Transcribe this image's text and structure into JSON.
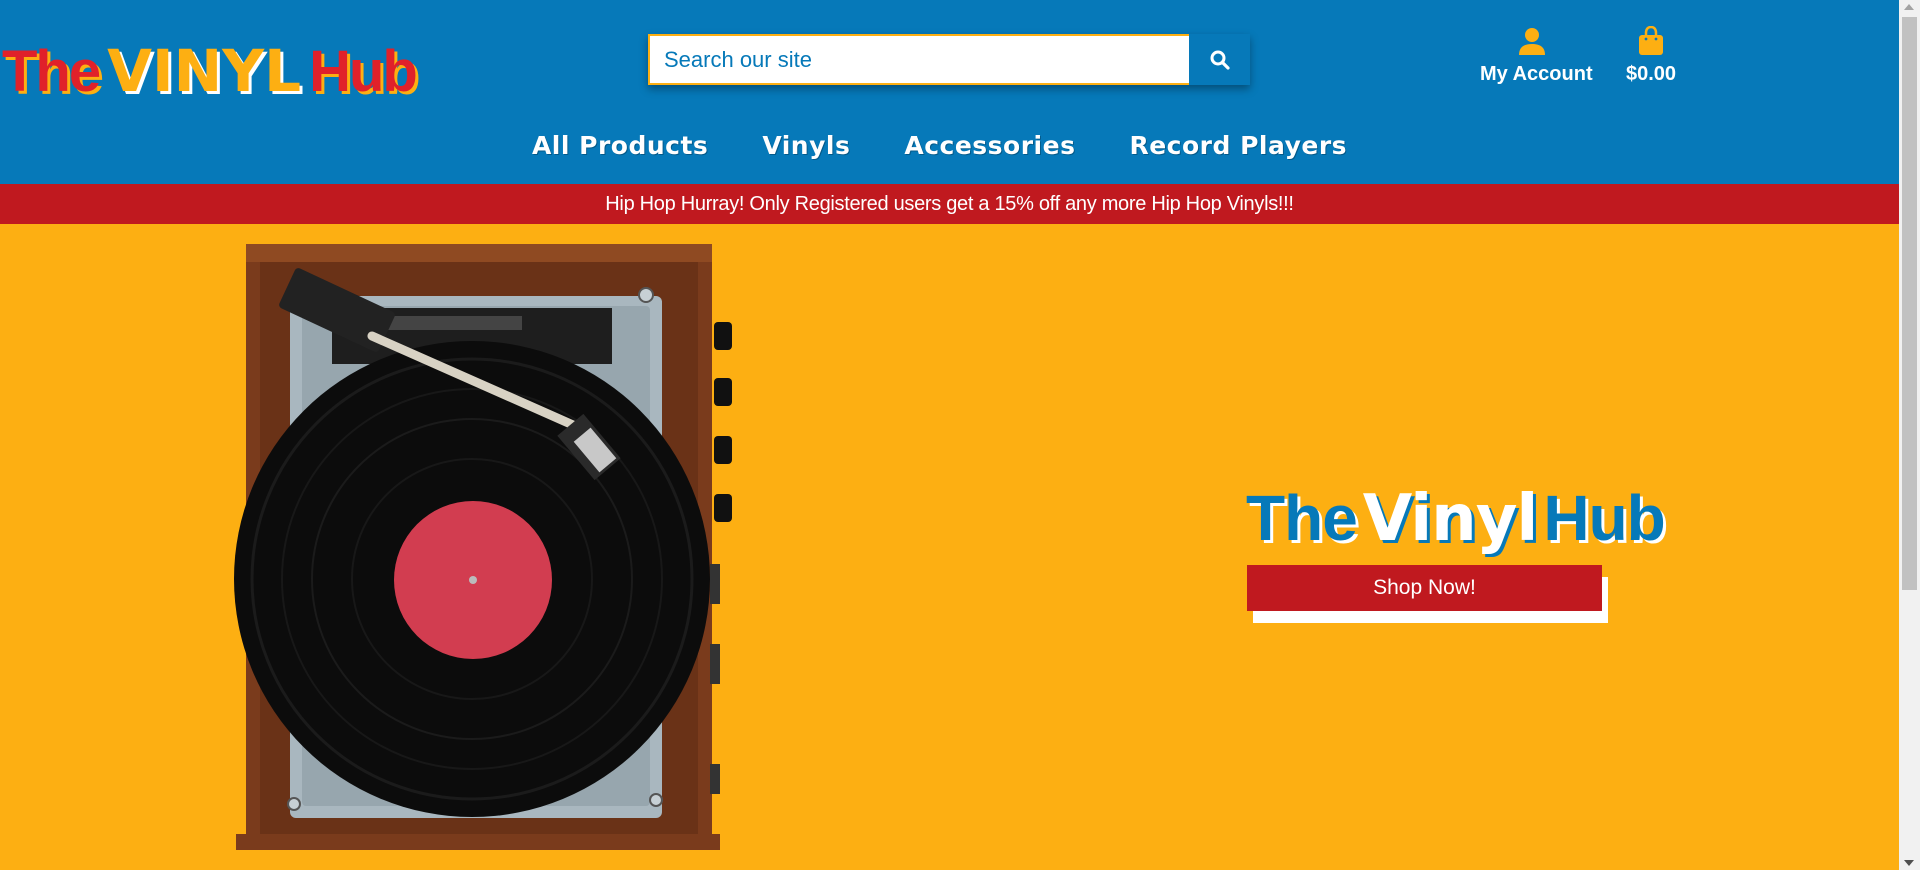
{
  "header": {
    "logo": {
      "word1": "The",
      "word2": "VINYL",
      "word3": "Hub"
    },
    "search": {
      "placeholder": "Search our site",
      "value": ""
    },
    "account_label": "My Account",
    "cart_total": "$0.00"
  },
  "nav": {
    "items": [
      "All Products",
      "Vinyls",
      "Accessories",
      "Record Players"
    ]
  },
  "promo": {
    "text": "Hip Hop Hurray! Only Registered users get a 15% off any more Hip Hop Vinyls!!!"
  },
  "hero": {
    "logo": {
      "word1": "The",
      "word2": "Vinyl",
      "word3": "Hub"
    },
    "button_label": "Shop Now!"
  },
  "colors": {
    "header_blue": "#0679b9",
    "accent_yellow": "#fdaf12",
    "promo_red": "#c0191f"
  },
  "icons": [
    "search-icon",
    "user-icon",
    "shopping-bag-icon"
  ]
}
